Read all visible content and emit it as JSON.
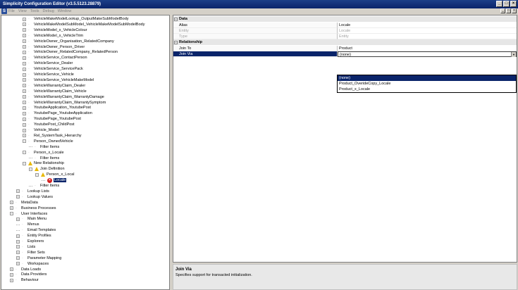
{
  "window": {
    "title": "Simplicity Configuration Editor (v3.5.5123.28879)",
    "buttons": [
      "_",
      "□",
      "×"
    ]
  },
  "menu": {
    "items": [
      "File",
      "View",
      "Tools",
      "Debug",
      "Window"
    ],
    "mdi_buttons": [
      "_",
      "□",
      "×"
    ]
  },
  "tree": [
    {
      "label": "VehicleMakeModelLookup_OutputMakeSubModelBody",
      "level": 3,
      "kind": "collapsed"
    },
    {
      "label": "VehicleMakeModelSubModel_VehicleMakeModelSubModelBody",
      "level": 3,
      "kind": "collapsed"
    },
    {
      "label": "VehicleModel_x_VehicleColour",
      "level": 3,
      "kind": "collapsed"
    },
    {
      "label": "VehicleModel_x_VehicleTrim",
      "level": 3,
      "kind": "collapsed"
    },
    {
      "label": "VehicleOwner_Organisation_RelatedCompany",
      "level": 3,
      "kind": "collapsed"
    },
    {
      "label": "VehicleOwner_Person_Driver",
      "level": 3,
      "kind": "collapsed"
    },
    {
      "label": "VehicleOwner_RelatedCompany_RelatedPerson",
      "level": 3,
      "kind": "collapsed"
    },
    {
      "label": "VehicleService_ContactPerson",
      "level": 3,
      "kind": "collapsed"
    },
    {
      "label": "VehicleService_Dealer",
      "level": 3,
      "kind": "collapsed"
    },
    {
      "label": "VehicleService_ServicePack",
      "level": 3,
      "kind": "collapsed"
    },
    {
      "label": "VehicleService_Vehicle",
      "level": 3,
      "kind": "collapsed"
    },
    {
      "label": "VehicleService_VehicleMakeModel",
      "level": 3,
      "kind": "collapsed"
    },
    {
      "label": "VehicleWarrantyClaim_Dealer",
      "level": 3,
      "kind": "collapsed"
    },
    {
      "label": "VehicleWarrantyClaim_Vehicle",
      "level": 3,
      "kind": "collapsed"
    },
    {
      "label": "VehicleWarrantyClaim_WarrantyDamage",
      "level": 3,
      "kind": "collapsed"
    },
    {
      "label": "VehicleWarrantyClaim_WarrantySymptom",
      "level": 3,
      "kind": "collapsed"
    },
    {
      "label": "YoutubeApplication_YoutubePost",
      "level": 3,
      "kind": "collapsed"
    },
    {
      "label": "YoutubePage_YoutubeApplication",
      "level": 3,
      "kind": "collapsed"
    },
    {
      "label": "YoutubePage_YoutubePost",
      "level": 3,
      "kind": "collapsed"
    },
    {
      "label": "YoutubePost_ChildPost",
      "level": 3,
      "kind": "collapsed"
    },
    {
      "label": "Vehicle_Model",
      "level": 3,
      "kind": "collapsed"
    },
    {
      "label": "Rel_SystemTask_Hierarchy",
      "level": 3,
      "kind": "collapsed"
    },
    {
      "label": "Person_OwnedVehicle",
      "level": 3,
      "kind": "expanded"
    },
    {
      "label": "Filter Items",
      "level": 4,
      "kind": "leaf"
    },
    {
      "label": "Person_x_Locale",
      "level": 3,
      "kind": "expanded"
    },
    {
      "label": "Filter Items",
      "level": 4,
      "kind": "leaf"
    },
    {
      "label": "New Relationship",
      "level": 3,
      "kind": "expanded",
      "icon": "warning"
    },
    {
      "label": "Join Definition",
      "level": 4,
      "kind": "expanded",
      "icon": "warning"
    },
    {
      "label": "Person_x_Local",
      "level": 5,
      "kind": "expanded",
      "icon": "warning"
    },
    {
      "label": "Locale",
      "level": 6,
      "kind": "leaf",
      "icon": "error",
      "selected": true
    },
    {
      "label": "Filter Items",
      "level": 4,
      "kind": "leaf"
    },
    {
      "label": "Lookup Lists",
      "level": 2,
      "kind": "collapsed"
    },
    {
      "label": "Lookup Values",
      "level": 2,
      "kind": "collapsed"
    },
    {
      "label": "MetaData",
      "level": 1,
      "kind": "collapsed"
    },
    {
      "label": "Business Processes",
      "level": 1,
      "kind": "collapsed"
    },
    {
      "label": "User Interfaces",
      "level": 1,
      "kind": "expanded"
    },
    {
      "label": "Main Menu",
      "level": 2,
      "kind": "collapsed"
    },
    {
      "label": "Menus",
      "level": 2,
      "kind": "leaf"
    },
    {
      "label": "Email Templates",
      "level": 2,
      "kind": "leaf"
    },
    {
      "label": "Entity Profiles",
      "level": 2,
      "kind": "collapsed"
    },
    {
      "label": "Explorers",
      "level": 2,
      "kind": "collapsed"
    },
    {
      "label": "Lists",
      "level": 2,
      "kind": "collapsed"
    },
    {
      "label": "Filter Sets",
      "level": 2,
      "kind": "collapsed"
    },
    {
      "label": "Parameter Mapping",
      "level": 2,
      "kind": "collapsed"
    },
    {
      "label": "Workspaces",
      "level": 2,
      "kind": "collapsed"
    },
    {
      "label": "Data Loads",
      "level": 1,
      "kind": "collapsed"
    },
    {
      "label": "Data Providers",
      "level": 1,
      "kind": "collapsed"
    },
    {
      "label": "Behaviour",
      "level": 1,
      "kind": "collapsed"
    }
  ],
  "properties": {
    "data_section": "Data",
    "data_rows": [
      {
        "name": "Alias",
        "value": "Locale",
        "disabled": false
      },
      {
        "name": "Entity",
        "value": "Locale",
        "disabled": true
      },
      {
        "name": "Type",
        "value": "Entity",
        "disabled": true
      }
    ],
    "relationship_section": "Relationship",
    "relationship_rows": [
      {
        "name": "Join To",
        "value": "Product",
        "disabled": false
      },
      {
        "name": "Join Via",
        "value": "(none)",
        "disabled": false,
        "selected": true
      }
    ]
  },
  "dropdown": {
    "options": [
      "(none)",
      "Product_OverideCopy_Locale",
      "Product_x_Locale"
    ],
    "highlighted_index": 0
  },
  "help": {
    "title": "Join Via",
    "description": "Specifies support for transacted initialization."
  },
  "colors": {
    "titlebar": "#0a246a",
    "selection": "#0a246a",
    "warning": "#e8b800",
    "error": "#d21e1e"
  }
}
